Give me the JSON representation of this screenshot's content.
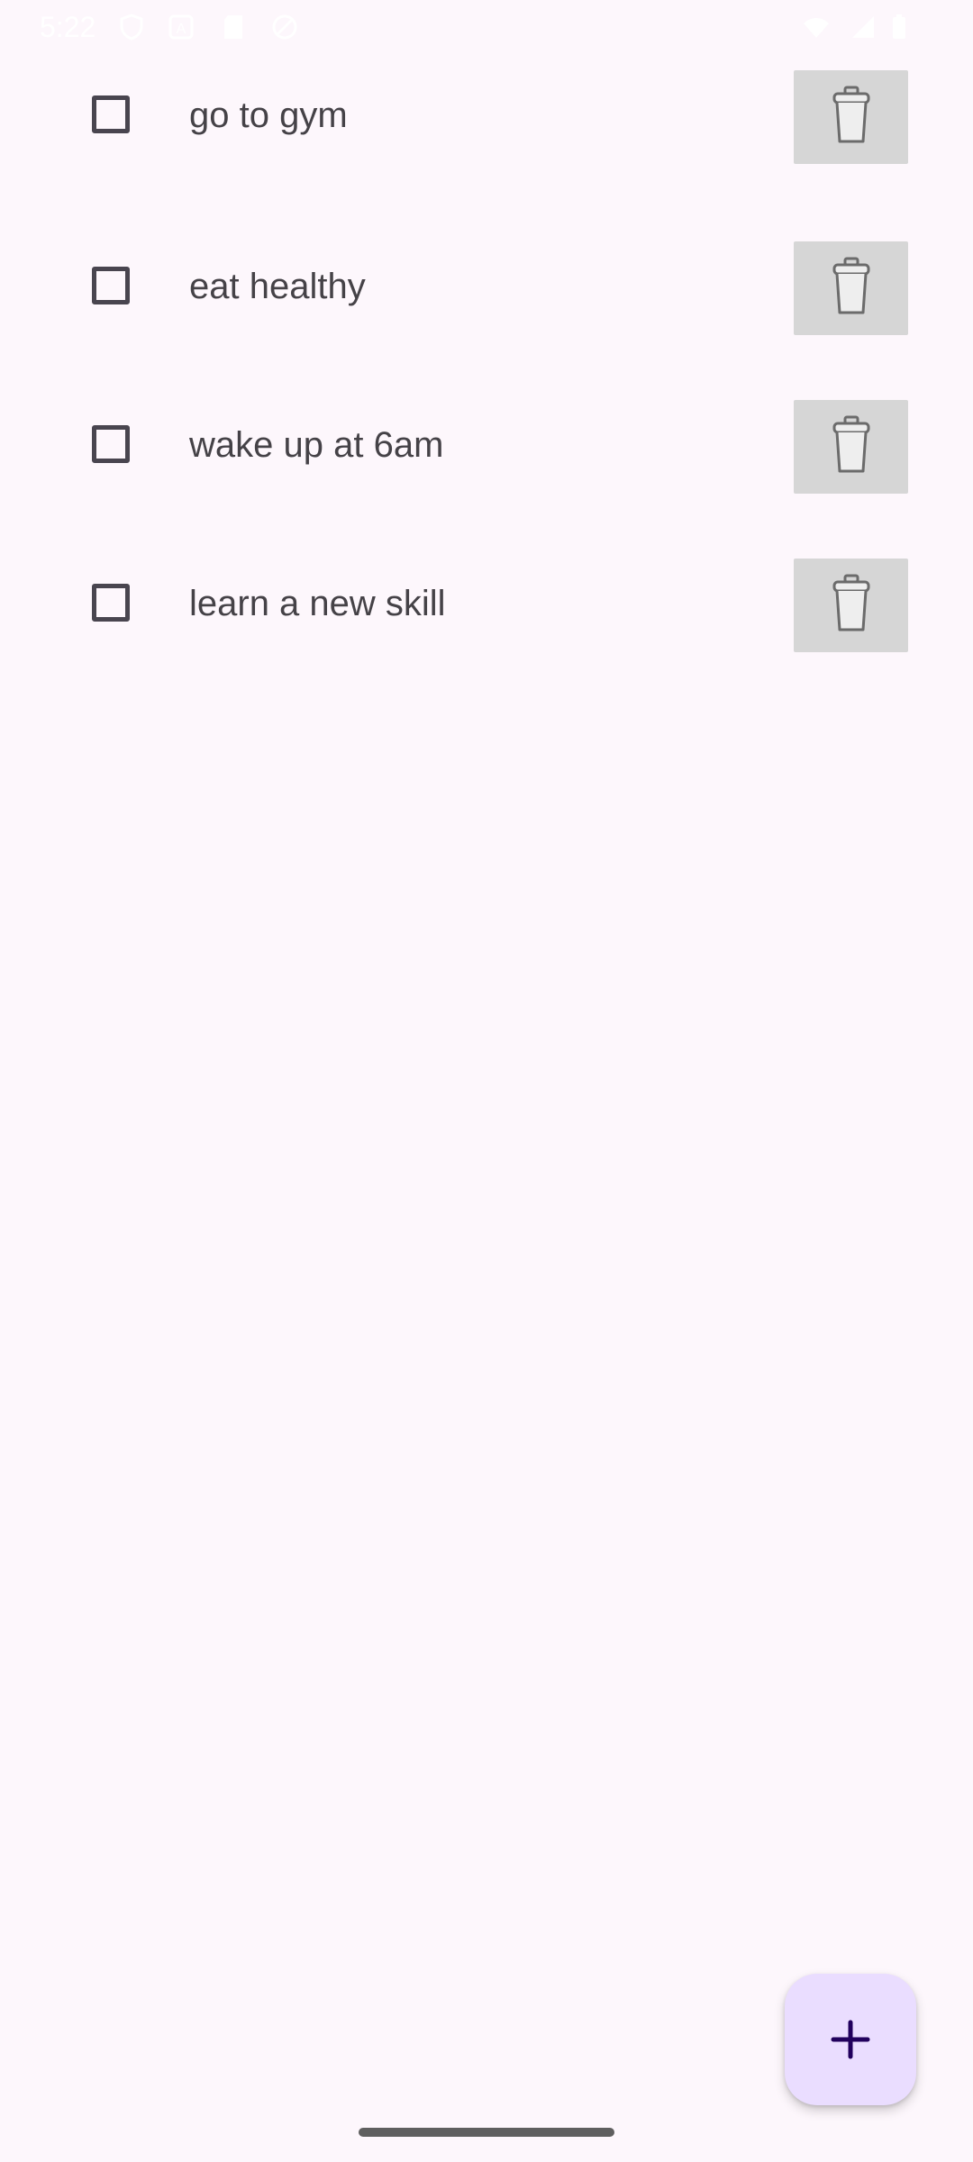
{
  "status_bar": {
    "time": "5:22",
    "left_icons": [
      "shield-icon",
      "a-icon",
      "sd-card-icon",
      "no-location-icon"
    ],
    "right_icons": [
      "wifi-icon",
      "cell-signal-icon",
      "battery-icon"
    ]
  },
  "todo_list": {
    "items": [
      {
        "label": "go to gym",
        "checked": false
      },
      {
        "label": "eat healthy",
        "checked": false
      },
      {
        "label": "wake up at 6am",
        "checked": false
      },
      {
        "label": "learn a new skill",
        "checked": false
      }
    ],
    "delete_icon": "trash-icon"
  },
  "fab": {
    "icon": "plus-icon",
    "background": "#eaddff",
    "icon_color": "#21005d"
  },
  "colors": {
    "background": "#fdf7fc",
    "checkbox_border": "#49454f",
    "text": "#1d1b20",
    "delete_button_bg": "#d6d6d6"
  }
}
